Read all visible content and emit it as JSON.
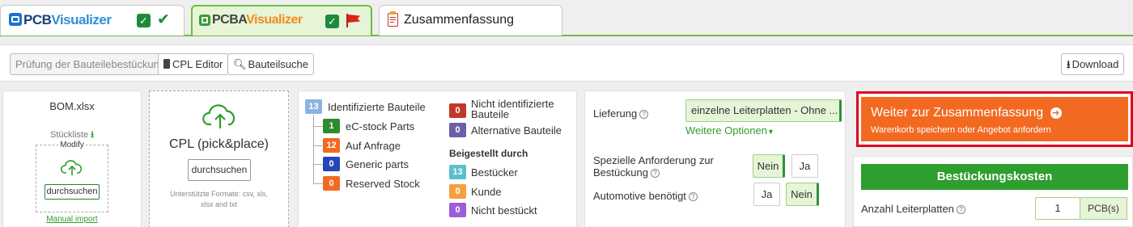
{
  "tabs": {
    "pcb": {
      "brand_a": "PCB",
      "brand_b": "Visualizer"
    },
    "pcba": {
      "brand_a": "PCBA",
      "brand_b": "Visualizer"
    },
    "summary": {
      "label": "Zusammenfassung"
    }
  },
  "toolbar": {
    "check_label": "Prüfung der Bauteilebestückung",
    "cpl_editor_label": "CPL Editor",
    "search_label": "Bauteilsuche",
    "download_label": "Download"
  },
  "bom": {
    "file_name": "BOM.xlsx",
    "stueckliste_label": "Stückliste",
    "modify_label": "Modify",
    "browse_label": "durchsuchen",
    "manual_import_label": "Manual import"
  },
  "cpl": {
    "title": "CPL (pick&place)",
    "browse_label": "durchsuchen",
    "formats_text": "Unterstützte Formate: csv, xls, xlsx and txt"
  },
  "parts": {
    "identified": {
      "count": "13",
      "label": "Identifizierte Bauteile"
    },
    "items": [
      {
        "count": "1",
        "label": "eC-stock Parts"
      },
      {
        "count": "12",
        "label": "Auf Anfrage"
      },
      {
        "count": "0",
        "label": "Generic parts"
      },
      {
        "count": "0",
        "label": "Reserved Stock"
      }
    ],
    "not_identified": {
      "count": "0",
      "label": "Nicht identifizierte Bauteile"
    },
    "alternative": {
      "count": "0",
      "label": "Alternative Bauteile"
    },
    "provided_heading": "Beigestellt durch",
    "provided": [
      {
        "count": "13",
        "label": "Bestücker"
      },
      {
        "count": "0",
        "label": "Kunde"
      },
      {
        "count": "0",
        "label": "Nicht bestückt"
      }
    ]
  },
  "options": {
    "delivery_label": "Lieferung",
    "delivery_value": "einzelne Leiterplatten - Ohne ...",
    "more_options_label": "Weitere Optionen",
    "special_label": "Spezielle Anforderung zur Bestückung",
    "special_no": "Nein",
    "special_yes": "Ja",
    "special_selected": "Nein",
    "automotive_label": "Automotive benötigt",
    "automotive_yes": "Ja",
    "automotive_no": "Nein",
    "automotive_selected": "Nein"
  },
  "cta": {
    "title": "Weiter zur Zusammenfassung",
    "subtitle": "Warenkorb speichern oder Angebot anfordern"
  },
  "costs": {
    "header": "Bestückungskosten",
    "boards_label": "Anzahl Leiterplatten",
    "boards_value": "1",
    "boards_unit": "PCB(s)"
  },
  "colors": {
    "accent_green": "#2e9e2e",
    "cta_orange": "#f26a21",
    "cta_border": "#e0001a"
  }
}
